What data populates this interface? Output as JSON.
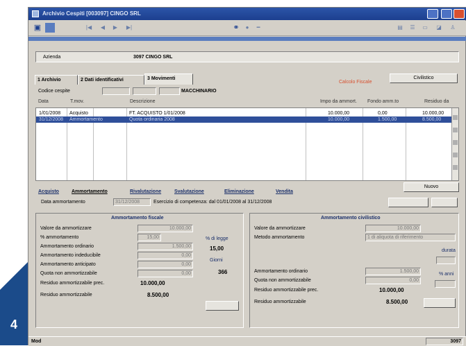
{
  "window": {
    "title": "Archivio Cespiti   [003097] CINGO SRL",
    "status_left": "Mod",
    "status_right": "3097"
  },
  "badge": "4",
  "header": {
    "azienda_label": "Azienda",
    "azienda_value": "3097  CINGO SRL"
  },
  "tabs": [
    {
      "label": "1 Archivio"
    },
    {
      "label": "2 Dati identificativi"
    },
    {
      "label": "3 Movimenti"
    }
  ],
  "calcolo_label": "Calcolo Fiscale",
  "civilistico_button": "Civilistico",
  "codice_cespite_label": "Codice cespite",
  "codice_cespite_desc": "MACCHINARIO",
  "grid": {
    "headers": [
      "Data",
      "T.mov.",
      "Descrizione",
      "Impo da ammort.",
      "Fondo amm.to",
      "Residuo da"
    ],
    "rows": [
      [
        "1/01/2008",
        "Acquisto",
        "FT. ACQUISTO  1/01/2008",
        "10.000,00",
        "0,00",
        "10.000,00"
      ],
      [
        "31/12/2008",
        "Ammortamento",
        "Quota ordinaria 2008",
        "10.000,00",
        "1.500,00",
        "8.500,00"
      ]
    ]
  },
  "nuovo_button": "Nuovo",
  "subtabs": [
    "Acquisto",
    "Ammortamento",
    "Rivalutazione",
    "Svalutazione",
    "Eliminazione",
    "Vendita"
  ],
  "data_ammortamento": {
    "label": "Data ammortamento",
    "value": "31/12/2008",
    "esercizio": "Esercizio di competenza: dal 01/01/2008 al 31/12/2008"
  },
  "fiscale": {
    "title": "Ammortamento fiscale",
    "rows": [
      {
        "label": "Valore da ammortizzare",
        "value": "10.000,00"
      },
      {
        "label": "% ammortamento",
        "value": "15,00"
      },
      {
        "label": "Ammortamento ordinario",
        "value": "1.500,00"
      },
      {
        "label": "Ammortamento indeducibile",
        "value": "0,00"
      },
      {
        "label": "Ammortamento anticipato",
        "value": "0,00"
      },
      {
        "label": "Quota non ammortizzabile",
        "value": "0,00"
      }
    ],
    "residuo_label": "Residuo ammortizzabile prec.",
    "residuo_value": "10.000,00",
    "residuo2_label": "Residuo ammortizzabile",
    "residuo2_value": "8.500,00",
    "pct_label": "% di legge",
    "pct_value": "15,00",
    "giorni_label": "Giorni",
    "giorni_value": "366"
  },
  "civilistico": {
    "title": "Ammortamento civilistico",
    "rows": [
      {
        "label": "Valore da ammortizzare",
        "value": "10.000,00"
      },
      {
        "label": "Metodo ammortamento",
        "value": "1 di aliquota di riferimento"
      }
    ],
    "durata_label": "durata",
    "ord_label": "Ammortamento ordinario",
    "ord_value": "1.500,00",
    "quota_label": "Quota non ammortizzabile",
    "quota_value": "0,00",
    "pct_label": "% anni",
    "residuo_label": "Residuo ammortizzabile prec.",
    "residuo_value": "10.000,00",
    "residuo2_label": "Residuo ammortizzabile",
    "residuo2_value": "8.500,00"
  }
}
